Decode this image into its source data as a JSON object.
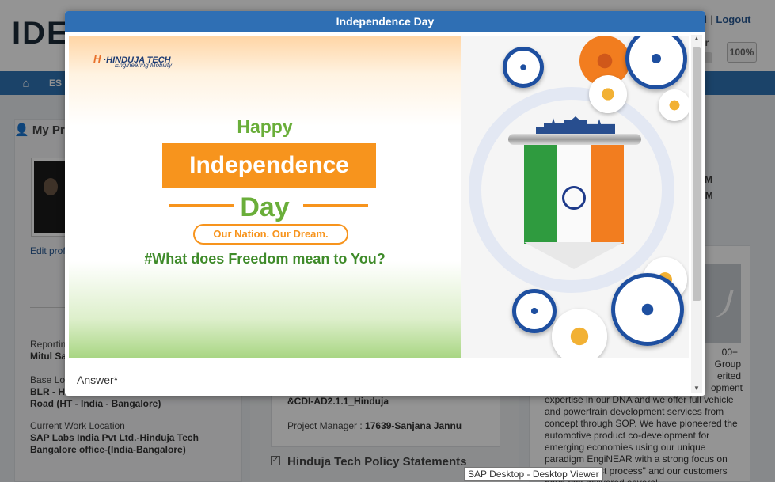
{
  "header": {
    "logo_text": "IDE",
    "logout_prefix": "rd",
    "logout": "Logout",
    "viewer_label": "er",
    "zoom": "100%",
    "progress": 0.7
  },
  "nav": {
    "home_icon": "home-icon",
    "first_item": "ES"
  },
  "profile": {
    "title": "My Pro",
    "edit_link": "Edit profi",
    "reporting_label": "Reportin",
    "reporting_value": "Mitul Sa",
    "base_label": "Base Lo",
    "base_line1": "BLR - H",
    "base_line2": "Road (HT - India - Bangalore)",
    "work_label": "Current Work Location",
    "work_line1": "SAP Labs India Pvt Ltd.-Hinduja Tech",
    "work_line2": "Bangalore office-(India-Bangalore)"
  },
  "middle": {
    "project_code": "&CDI-AD2.1.1_Hinduja",
    "pm_label": "Project Manager : ",
    "pm_value": "17639-Sanjana Jannu",
    "policy_title": "Hinduja Tech Policy Statements"
  },
  "right": {
    "time1": "PM",
    "time2": "RM",
    "desc_line1": "00+",
    "desc_line2": "Group",
    "desc_line3": "erited",
    "desc_line4": "opment",
    "desc_body": "expertise in our DNA and we offer full vehicle and powertrain development services from concept through SOP. We have pioneered the automotive product co-development for emerging economies using our unique paradigm EngiNEAR with a strong focus on \"design to cost process\" and our customers have fast delivered several"
  },
  "modal": {
    "title": "Independence Day",
    "banner": {
      "company": "HINDUJA TECH",
      "tagline": "Engineering Mobility",
      "happy": "Happy",
      "independence": "Independence",
      "day": "Day",
      "pill": "Our Nation. Our Dream.",
      "hashtag_pre": "#What does ",
      "hashtag_freedom": "Freedom",
      "hashtag_mid": " mean to ",
      "hashtag_you": "You?"
    },
    "answer_label": "Answer*"
  },
  "tooltip": "SAP Desktop - Desktop Viewer",
  "colors": {
    "accent": "#2f6fb4",
    "saffron": "#f7941d",
    "green": "#6aae3a"
  }
}
